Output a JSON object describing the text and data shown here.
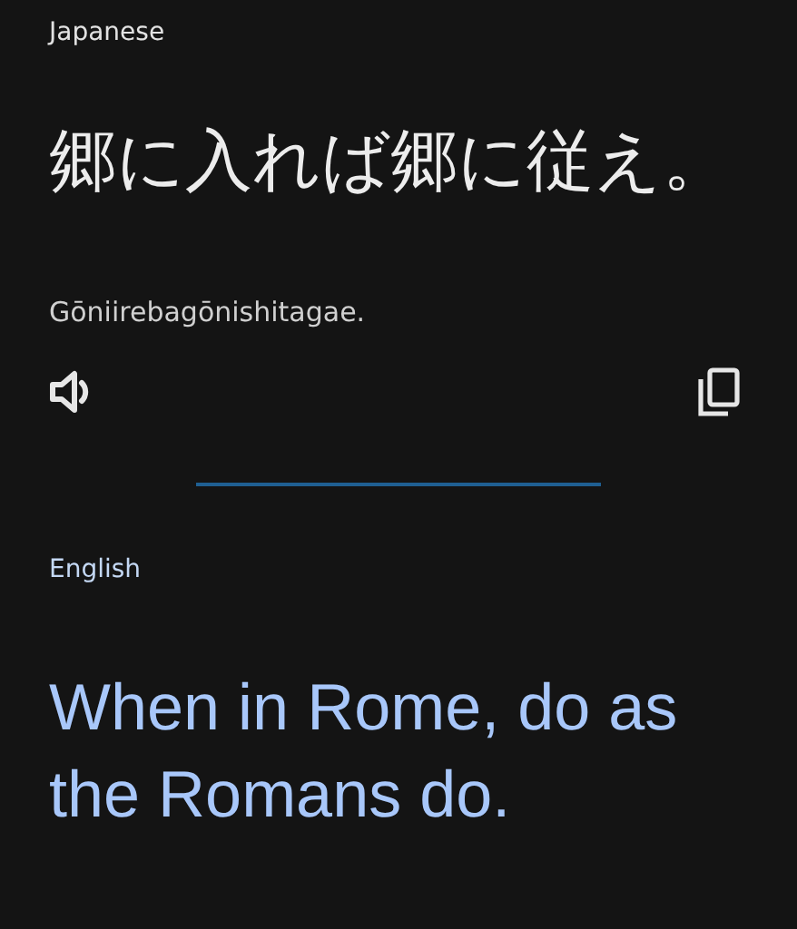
{
  "source": {
    "language": "Japanese",
    "text": "郷に入れば郷に従え。",
    "romanization": "Gōniirebagōnishitagae."
  },
  "target": {
    "language": "English",
    "text": "When in Rome, do as the Romans do."
  }
}
